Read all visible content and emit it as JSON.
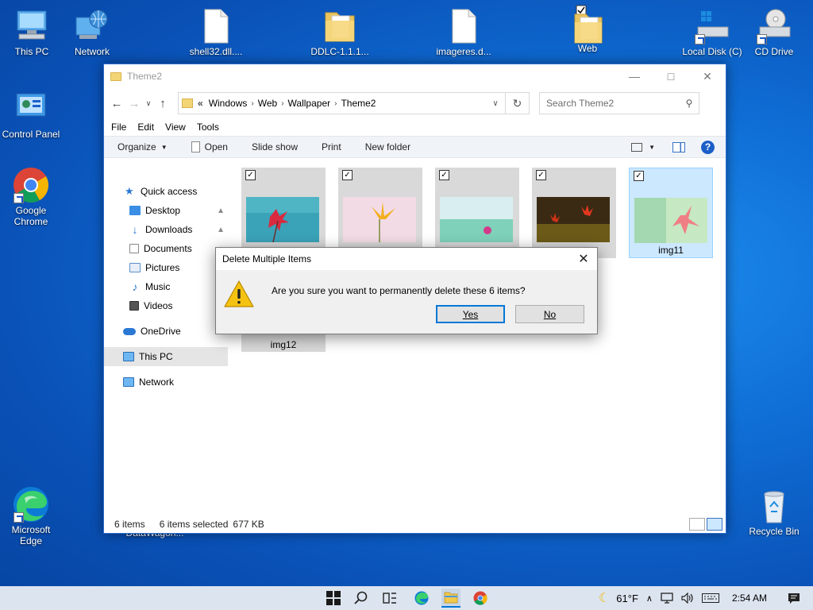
{
  "desktop": {
    "icons": [
      {
        "label": "This PC"
      },
      {
        "label": "Network"
      },
      {
        "label": "shell32.dll...."
      },
      {
        "label": "DDLC-1.1.1..."
      },
      {
        "label": "imageres.d..."
      },
      {
        "label": "Web"
      },
      {
        "label": "Local Disk (C)"
      },
      {
        "label": "CD Drive"
      },
      {
        "label": "Control Panel"
      },
      {
        "label": "Google Chrome"
      },
      {
        "label": "Microsoft Edge"
      },
      {
        "label": "Recycle Bin"
      },
      {
        "label": "DataWagon..."
      }
    ]
  },
  "explorer": {
    "title": "Theme2",
    "breadcrumb": [
      "Windows",
      "Web",
      "Wallpaper",
      "Theme2"
    ],
    "breadcrumb_prefix": "«",
    "search_placeholder": "Search Theme2",
    "menu": [
      "File",
      "Edit",
      "View",
      "Tools"
    ],
    "commands": {
      "organize": "Organize",
      "open": "Open",
      "slideshow": "Slide show",
      "print": "Print",
      "new_folder": "New folder"
    },
    "nav": [
      {
        "label": "Quick access"
      },
      {
        "label": "Desktop"
      },
      {
        "label": "Downloads"
      },
      {
        "label": "Documents"
      },
      {
        "label": "Pictures"
      },
      {
        "label": "Music"
      },
      {
        "label": "Videos"
      },
      {
        "label": "OneDrive"
      },
      {
        "label": "This PC"
      },
      {
        "label": "Network"
      }
    ],
    "thumbnails": [
      {
        "name": "",
        "checked": true,
        "selected": false
      },
      {
        "name": "",
        "checked": true,
        "selected": false
      },
      {
        "name": "",
        "checked": true,
        "selected": false
      },
      {
        "name": "",
        "checked": true,
        "selected": false
      },
      {
        "name": "img11",
        "checked": true,
        "selected": true
      },
      {
        "name": "img12",
        "checked": false,
        "selected": false
      }
    ],
    "status": {
      "count": "6 items",
      "selected": "6 items selected",
      "size": "677 KB"
    }
  },
  "dialog": {
    "title": "Delete Multiple Items",
    "message": "Are you sure you want to permanently delete these 6 items?",
    "yes_label": "Yes",
    "no_label": "No"
  },
  "taskbar": {
    "weather_temp": "61°F",
    "time": "2:54 AM"
  },
  "colors": {
    "accent": "#0078d7",
    "selection": "#cce8ff",
    "desktop": "#0a52b8"
  }
}
